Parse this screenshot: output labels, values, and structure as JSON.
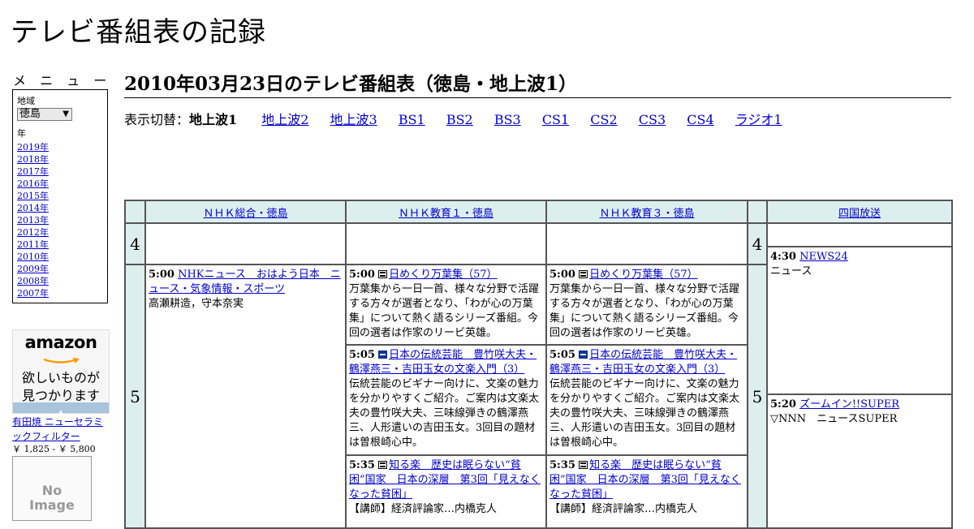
{
  "site": {
    "title": "テレビ番組表の記録"
  },
  "menu": {
    "label": "メ ニ ュ ー",
    "region_label": "地域",
    "region_value": "徳島",
    "year_label": "年",
    "years": [
      "2019年",
      "2018年",
      "2017年",
      "2016年",
      "2015年",
      "2014年",
      "2013年",
      "2012年",
      "2011年",
      "2010年",
      "2009年",
      "2008年",
      "2007年"
    ]
  },
  "ad": {
    "logo": "amazon",
    "copy_line1": "欲しいものが",
    "copy_line2": "見つかります",
    "privacy": "プライバシーについて",
    "product": "有田焼 ニューセラミックフィルター",
    "price": "￥ 1,825 - ￥ 5,800",
    "noimage_line1": "No",
    "noimage_line2": "Image"
  },
  "heading": "2010年03月23日のテレビ番組表（徳島・地上波1）",
  "switcher": {
    "label": "表示切替：",
    "current": "地上波1",
    "links": [
      "地上波2",
      "地上波3",
      "BS1",
      "BS2",
      "BS3",
      "CS1",
      "CS2",
      "CS3",
      "CS4",
      "ラジオ1"
    ]
  },
  "channels": [
    "ＮＨＫ総合・徳島",
    "ＮＨＫ教育１・徳島",
    "ＮＨＫ教育３・徳島",
    "四国放送"
  ],
  "hours": [
    "4",
    "5"
  ],
  "programs": {
    "nhk_sogo": [
      {
        "time": "5:00",
        "title": "NHKニュース　おはよう日本　ニュース・気象情報・スポーツ",
        "desc": "高瀬耕造，守本奈実"
      }
    ],
    "nhk_edu1": [
      {
        "time": "5:00",
        "icon": "ji-icon",
        "title": "日めくり万葉集（57）",
        "desc": "万葉集から一日一首、様々な分野で活躍する方々が選者となり、「わが心の万葉集」について熱く語るシリーズ番組。今回の選者は作家のリービ英雄。"
      },
      {
        "time": "5:05",
        "icon": "subtitle-icon",
        "title": "日本の伝統芸能　豊竹咲大夫・鶴澤燕三・吉田玉女の文楽入門（3）",
        "desc": "伝統芸能のビギナー向けに、文楽の魅力を分かりやすくご紹介。ご案内は文楽太夫の豊竹咲大夫、三味線弾きの鶴澤燕三、人形遣いの吉田玉女。3回目の題材は曽根崎心中。"
      },
      {
        "time": "5:35",
        "icon": "ji-icon",
        "title": "知る楽　歴史は眠らない“貧困”国家　日本の深層　第3回「見えなくなった貧困」",
        "desc": "【講師】経済評論家…内橋克人"
      }
    ],
    "nhk_edu3": [
      {
        "time": "5:00",
        "icon": "ji-icon",
        "title": "日めくり万葉集（57）",
        "desc": "万葉集から一日一首、様々な分野で活躍する方々が選者となり、「わが心の万葉集」について熱く語るシリーズ番組。今回の選者は作家のリービ英雄。"
      },
      {
        "time": "5:05",
        "icon": "subtitle-icon",
        "title": "日本の伝統芸能　豊竹咲大夫・鶴澤燕三・吉田玉女の文楽入門（3）",
        "desc": "伝統芸能のビギナー向けに、文楽の魅力を分かりやすくご紹介。ご案内は文楽太夫の豊竹咲大夫、三味線弾きの鶴澤燕三、人形遣いの吉田玉女。3回目の題材は曽根崎心中。"
      },
      {
        "time": "5:35",
        "icon": "ji-icon",
        "title": "知る楽　歴史は眠らない“貧困”国家　日本の深層　第3回「見えなくなった貧困」",
        "desc": "【講師】経済評論家…内橋克人"
      }
    ],
    "shikoku": [
      {
        "time": "4:30",
        "title": "NEWS24",
        "desc": "ニュース"
      },
      {
        "time": "5:20",
        "title": "ズームイン!!SUPER",
        "desc": "▽NNN　ニュースSUPER"
      }
    ]
  }
}
